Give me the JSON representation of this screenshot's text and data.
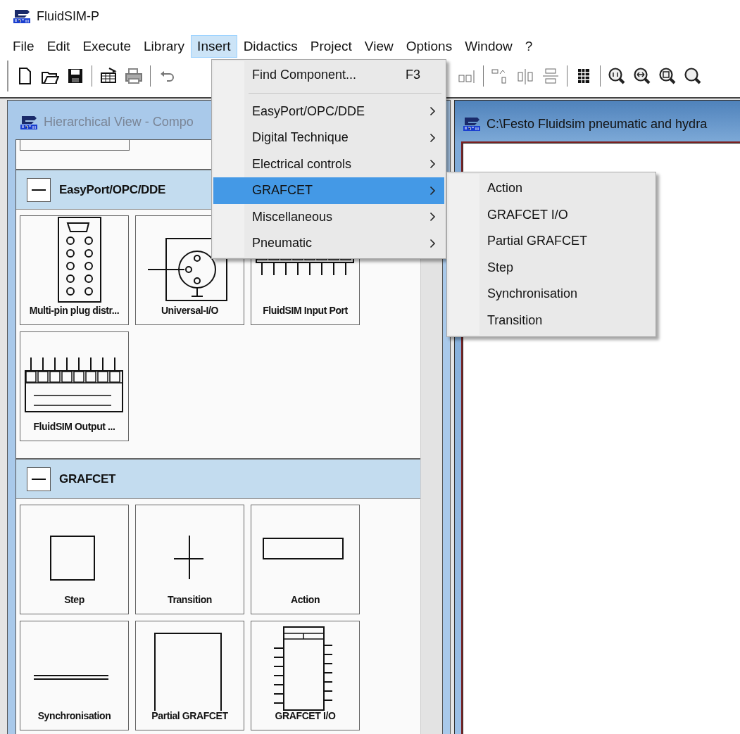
{
  "app": {
    "title": "FluidSIM-P"
  },
  "menu_bar": [
    {
      "label": "File",
      "selected": false
    },
    {
      "label": "Edit",
      "selected": false
    },
    {
      "label": "Execute",
      "selected": false
    },
    {
      "label": "Library",
      "selected": false
    },
    {
      "label": "Insert",
      "selected": true
    },
    {
      "label": "Didactics",
      "selected": false
    },
    {
      "label": "Project",
      "selected": false
    },
    {
      "label": "View",
      "selected": false
    },
    {
      "label": "Options",
      "selected": false
    },
    {
      "label": "Window",
      "selected": false
    },
    {
      "label": "?",
      "selected": false
    }
  ],
  "insert_menu": [
    {
      "kind": "command",
      "label": "Find Component...",
      "shortcut": "F3"
    },
    {
      "kind": "separator"
    },
    {
      "kind": "submenu",
      "label": "EasyPort/OPC/DDE",
      "selected": false
    },
    {
      "kind": "submenu",
      "label": "Digital Technique",
      "selected": false
    },
    {
      "kind": "submenu",
      "label": "Electrical controls",
      "selected": false
    },
    {
      "kind": "submenu",
      "label": "GRAFCET",
      "selected": true
    },
    {
      "kind": "submenu",
      "label": "Miscellaneous",
      "selected": false
    },
    {
      "kind": "submenu",
      "label": "Pneumatic",
      "selected": false
    }
  ],
  "grafcet_submenu": [
    "Action",
    "GRAFCET I/O",
    "Partial GRAFCET",
    "Step",
    "Synchronisation",
    "Transition"
  ],
  "component_view": {
    "title": "Hierarchical View - Compo",
    "groups": [
      {
        "name": "EasyPort/OPC/DDE",
        "expanded": true,
        "components": [
          {
            "label": "Multi-pin plug distr...",
            "kind": "multipin"
          },
          {
            "label": "Universal-I/O",
            "kind": "universal-io"
          },
          {
            "label": "FluidSIM Input Port",
            "kind": "input-port"
          },
          {
            "label": "FluidSIM Output ...",
            "kind": "output-port"
          }
        ]
      },
      {
        "name": "GRAFCET",
        "expanded": true,
        "components": [
          {
            "label": "Step",
            "kind": "step"
          },
          {
            "label": "Transition",
            "kind": "transition"
          },
          {
            "label": "Action",
            "kind": "action"
          },
          {
            "label": "Synchronisation",
            "kind": "synchronisation"
          },
          {
            "label": "Partial GRAFCET",
            "kind": "partial-grafcet"
          },
          {
            "label": "GRAFCET I/O",
            "kind": "grafcet-io"
          }
        ]
      }
    ]
  },
  "circuit_window": {
    "title": "C:\\Festo Fluidsim pneumatic and hydra"
  }
}
